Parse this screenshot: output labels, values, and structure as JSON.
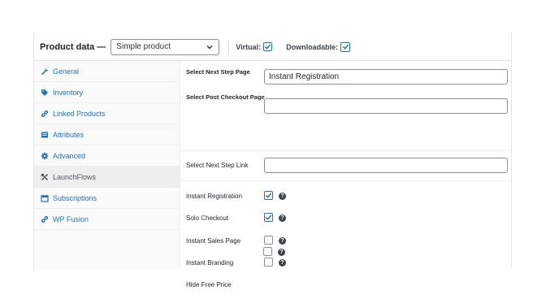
{
  "header": {
    "title": "Product data —",
    "product_type": "Simple product",
    "virtual_label": "Virtual:",
    "virtual_checked": true,
    "downloadable_label": "Downloadable:",
    "downloadable_checked": true
  },
  "sidebar": {
    "items": [
      {
        "label": "General",
        "icon": "wrench-icon",
        "active": false
      },
      {
        "label": "Inventory",
        "icon": "tag-icon",
        "active": false
      },
      {
        "label": "Linked Products",
        "icon": "link-icon",
        "active": false
      },
      {
        "label": "Attributes",
        "icon": "list-icon",
        "active": false
      },
      {
        "label": "Advanced",
        "icon": "gear-icon",
        "active": false
      },
      {
        "label": "LaunchFlows",
        "icon": "arrows-icon",
        "active": true
      },
      {
        "label": "Subscriptions",
        "icon": "calendar-icon",
        "active": false
      },
      {
        "label": "WP Fusion",
        "icon": "link-icon",
        "active": false
      }
    ]
  },
  "fields": {
    "next_step_page": {
      "label": "Select Next Step Page",
      "value": "Instant Registration"
    },
    "post_checkout_page": {
      "label": "Select Post Checkout Page",
      "value": ""
    },
    "next_step_link": {
      "label": "Select Next Step Link",
      "value": ""
    }
  },
  "options": [
    {
      "label": "Instant Registration",
      "checked": true
    },
    {
      "label": "Solo Checkout",
      "checked": true
    },
    {
      "label": "Instant Sales Page",
      "checked": false
    },
    {
      "label": "Instant Branding",
      "checked": false
    },
    {
      "label": "Hide Free Price",
      "checked": false
    }
  ],
  "help_glyph": "?",
  "colors": {
    "accent": "#2271b1",
    "active_tab_bg": "#eeeeee",
    "border": "#8c8f94"
  }
}
